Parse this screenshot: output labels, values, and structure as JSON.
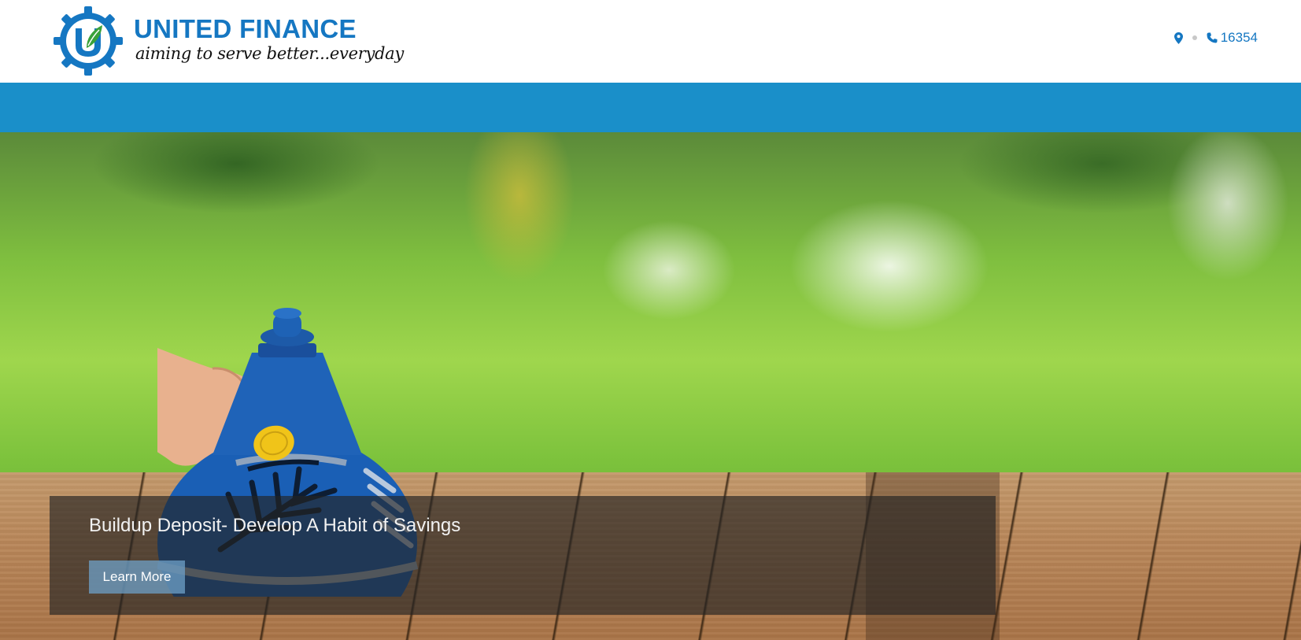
{
  "brand": {
    "name": "UNITED FINANCE",
    "tagline": "aiming to serve better...everyday",
    "logo_icon": "gear-leaf-logo-icon",
    "color_primary": "#1577c2"
  },
  "header": {
    "contact": {
      "location_icon": "map-marker-icon",
      "phone_icon": "phone-icon",
      "phone": "16354"
    }
  },
  "navbar": {
    "color": "#1a8fc9",
    "items": []
  },
  "hero": {
    "slide": {
      "title": "Buildup Deposit- Develop A Habit of Savings",
      "button_label": "Learn More"
    }
  }
}
